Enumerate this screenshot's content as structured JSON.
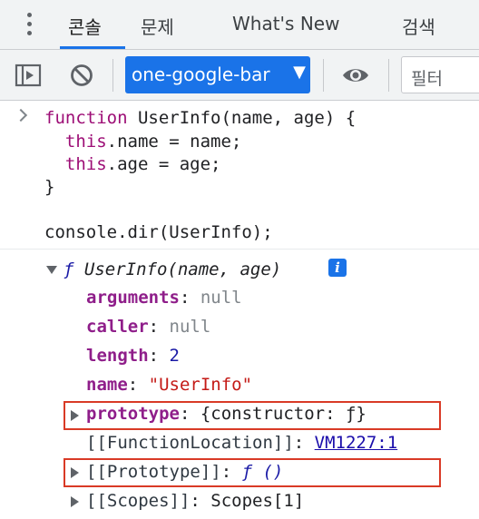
{
  "tabs": [
    {
      "label": "콘솔",
      "active": true
    },
    {
      "label": "문제",
      "active": false
    },
    {
      "label": "What's New",
      "active": false
    },
    {
      "label": "검색",
      "active": false
    }
  ],
  "toolbar": {
    "context": "one-google-bar",
    "filter_placeholder": "필터"
  },
  "console": {
    "input_lines": [
      "function UserInfo(name, age) {",
      "  this.name = name;",
      "  this.age = age;",
      "}",
      "console.dir(UserInfo);"
    ],
    "object_header": "f UserInfo(name, age)",
    "info_badge": "i",
    "properties": [
      {
        "key": "arguments",
        "value": "null"
      },
      {
        "key": "caller",
        "value": "null"
      },
      {
        "key": "length",
        "value": "2"
      },
      {
        "key": "name",
        "value": "\"UserInfo\""
      },
      {
        "key": "prototype",
        "value": "{constructor: ƒ}"
      },
      {
        "key": "[[FunctionLocation]]",
        "value": "VM1227:1"
      },
      {
        "key": "[[Prototype]]",
        "value": "ƒ ()"
      },
      {
        "key": "[[Scopes]]",
        "value": "Scopes[1]"
      }
    ]
  },
  "colors": {
    "accent": "#1a73e8",
    "highlight_box": "#d93a26",
    "keyword": "#9d0e76",
    "property": "#8f1e8a"
  }
}
